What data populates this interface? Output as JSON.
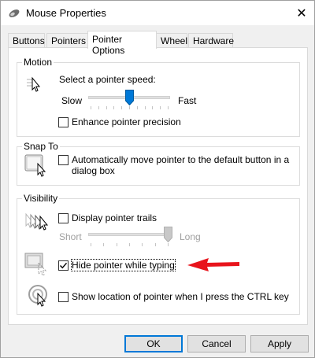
{
  "window": {
    "title": "Mouse Properties",
    "close_glyph": "✕"
  },
  "tabs": [
    {
      "label": "Buttons"
    },
    {
      "label": "Pointers"
    },
    {
      "label": "Pointer Options"
    },
    {
      "label": "Wheel"
    },
    {
      "label": "Hardware"
    }
  ],
  "motion": {
    "group_label": "Motion",
    "speed_label": "Select a pointer speed:",
    "slow_label": "Slow",
    "fast_label": "Fast",
    "speed_value": 0.5,
    "enhance_label": "Enhance pointer precision",
    "enhance_checked": false
  },
  "snap": {
    "group_label": "Snap To",
    "snap_label_line1": "Automatically move pointer to the default button in a",
    "snap_label_line2": "dialog box",
    "snap_checked": false
  },
  "visibility": {
    "group_label": "Visibility",
    "trails_label": "Display pointer trails",
    "trails_checked": false,
    "short_label": "Short",
    "long_label": "Long",
    "trails_value": 1.0,
    "hide_label": "Hide pointer while typing",
    "hide_checked": true,
    "show_label": "Show location of pointer when I press the CTRL key",
    "show_checked": false
  },
  "buttons": {
    "ok": "OK",
    "cancel": "Cancel",
    "apply": "Apply"
  },
  "colors": {
    "accent": "#0078d7",
    "annotation_arrow": "#e8141c"
  }
}
